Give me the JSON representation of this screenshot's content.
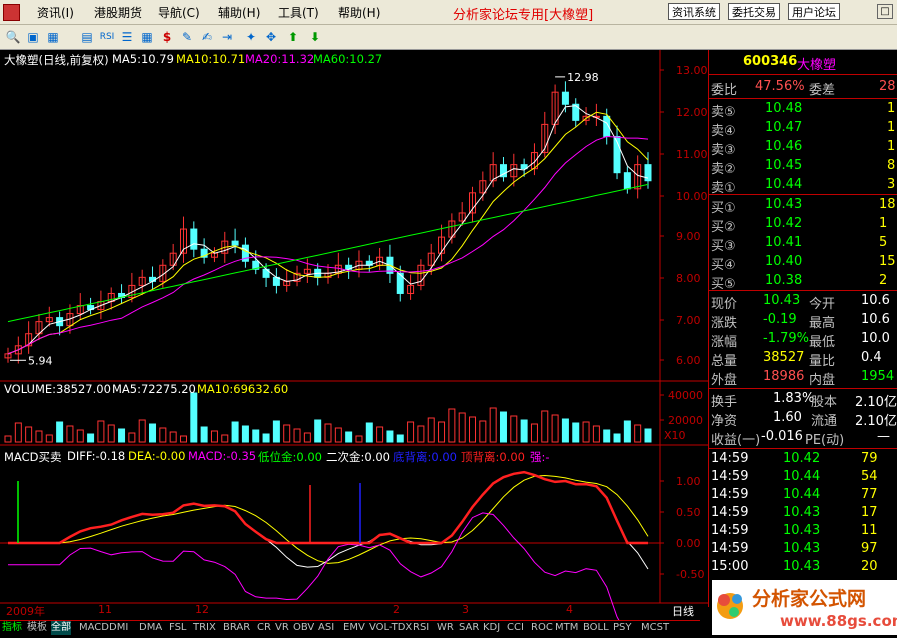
{
  "menubar": {
    "items": [
      "资讯(I)",
      "港股期货",
      "导航(C)",
      "辅助(H)",
      "工具(T)",
      "帮助(H)"
    ],
    "title": "分析家论坛专用[大橡塑]",
    "buttons": [
      "资讯系统",
      "委托交易",
      "用户论坛"
    ]
  },
  "chart": {
    "header": {
      "name": "大橡塑(日线,前复权)",
      "ma5": "MA5:10.79",
      "ma10": "MA10:10.71",
      "ma20": "MA20:11.32",
      "ma60": "MA60:10.27"
    },
    "high_label": "12.98",
    "low_label": "5.94",
    "price_ticks": [
      "13.00",
      "12.00",
      "11.00",
      "10.00",
      "9.00",
      "8.00",
      "7.00",
      "6.00"
    ],
    "volume_header": {
      "volume": "VOLUME:38527.00",
      "ma5": "MA5:72275.20",
      "ma10": "MA10:69632.60"
    },
    "volume_ticks": [
      "40000",
      "20000"
    ],
    "volume_unit": "X10",
    "macd_header": {
      "name": "MACD买卖",
      "diff": "DIFF:-0.18",
      "dea": "DEA:-0.00",
      "macd": "MACD:-0.35",
      "low_gold": "低位金:0.00",
      "second_gold": "二次金:0.00",
      "bottom_div": "底背离:0.00",
      "top_div": "顶背离:0.00",
      "strong": "强:-"
    },
    "macd_ticks": [
      "1.00",
      "0.50",
      "0.00",
      "-0.50"
    ],
    "time_labels": [
      "2009年",
      "11",
      "12",
      "2",
      "3",
      "4"
    ],
    "period_label": "日线",
    "colors": {
      "up": "#ff3333",
      "down": "#54ffff",
      "ma5": "#ffffff",
      "ma10": "#ffff00",
      "ma20": "#ff00ff",
      "ma60": "#00ff00",
      "axis": "#c00000"
    }
  },
  "chart_data": {
    "type": "candlestick",
    "title": "大橡塑(日线,前复权)",
    "close_approx": [
      6.1,
      6.3,
      6.6,
      6.9,
      7.0,
      6.8,
      7.1,
      7.3,
      7.2,
      7.4,
      7.6,
      7.5,
      7.8,
      8.0,
      7.9,
      8.3,
      8.6,
      9.2,
      8.7,
      8.5,
      8.6,
      8.9,
      8.8,
      8.4,
      8.2,
      8.0,
      7.8,
      7.9,
      8.1,
      8.2,
      8.0,
      8.1,
      8.3,
      8.2,
      8.4,
      8.3,
      8.5,
      8.1,
      7.6,
      7.8,
      8.3,
      8.6,
      9.0,
      9.4,
      9.6,
      10.1,
      10.4,
      10.8,
      10.5,
      10.8,
      10.7,
      11.1,
      11.8,
      12.6,
      12.3,
      11.9,
      12.0,
      12.0,
      11.5,
      10.6,
      10.2,
      10.8,
      10.4
    ],
    "ylim": [
      5.5,
      13.3
    ]
  },
  "rightpanel": {
    "code": "600346",
    "name": "大橡塑",
    "wb_label": "委比",
    "wb_value": "47.56%",
    "wc_label": "委差",
    "wc_value": "28",
    "sell": [
      {
        "label": "卖⑤",
        "price": "10.48",
        "vol": "1"
      },
      {
        "label": "卖④",
        "price": "10.47",
        "vol": "1"
      },
      {
        "label": "卖③",
        "price": "10.46",
        "vol": "1"
      },
      {
        "label": "卖②",
        "price": "10.45",
        "vol": "8"
      },
      {
        "label": "卖①",
        "price": "10.44",
        "vol": "3"
      }
    ],
    "buy": [
      {
        "label": "买①",
        "price": "10.43",
        "vol": "18"
      },
      {
        "label": "买②",
        "price": "10.42",
        "vol": "1"
      },
      {
        "label": "买③",
        "price": "10.41",
        "vol": "5"
      },
      {
        "label": "买④",
        "price": "10.40",
        "vol": "15"
      },
      {
        "label": "买⑤",
        "price": "10.38",
        "vol": "2"
      }
    ],
    "stats": [
      {
        "l1": "现价",
        "v1": "10.43",
        "l2": "今开",
        "v2": "10.6"
      },
      {
        "l1": "涨跌",
        "v1": "-0.19",
        "l2": "最高",
        "v2": "10.6"
      },
      {
        "l1": "涨幅",
        "v1": "-1.79%",
        "l2": "最低",
        "v2": "10.0"
      },
      {
        "l1": "总量",
        "v1": "38527",
        "l2": "量比",
        "v2": "0.4"
      },
      {
        "l1": "外盘",
        "v1": "18986",
        "l2": "内盘",
        "v2": "1954"
      }
    ],
    "stats2": [
      {
        "l1": "换手",
        "v1": "1.83%",
        "l2": "股本",
        "v2": "2.10亿"
      },
      {
        "l1": "净资",
        "v1": "1.60",
        "l2": "流通",
        "v2": "2.10亿"
      },
      {
        "l1": "收益(一)",
        "v1": "-0.016",
        "l2": "PE(动)",
        "v2": "—"
      }
    ],
    "ticks": [
      {
        "time": "14:59",
        "price": "10.42",
        "vol": "79"
      },
      {
        "time": "14:59",
        "price": "10.44",
        "vol": "54"
      },
      {
        "time": "14:59",
        "price": "10.44",
        "vol": "77"
      },
      {
        "time": "14:59",
        "price": "10.43",
        "vol": "17"
      },
      {
        "time": "14:59",
        "price": "10.43",
        "vol": "11"
      },
      {
        "time": "14:59",
        "price": "10.43",
        "vol": "97"
      },
      {
        "time": "15:00",
        "price": "10.43",
        "vol": "20"
      }
    ]
  },
  "bottomtabs": [
    "指标",
    "模板",
    "全部",
    "MACD",
    "DMI",
    "DMA",
    "FSL",
    "TRIX",
    "BRAR",
    "CR",
    "VR",
    "OBV",
    "ASI",
    "EMV",
    "VOL-TDX",
    "RSI",
    "WR",
    "SAR",
    "KDJ",
    "CCI",
    "ROC",
    "MTM",
    "BOLL",
    "PSY",
    "MCST"
  ],
  "logo": {
    "text": "分析家公式网",
    "url": "www.88gs.com"
  }
}
